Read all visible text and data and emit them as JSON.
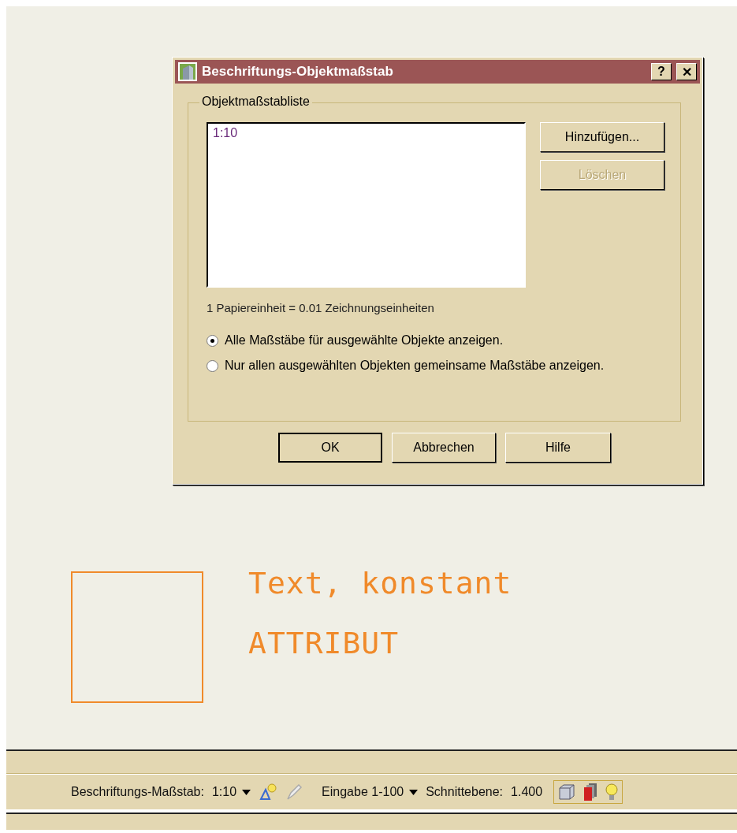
{
  "dialog": {
    "title": "Beschriftungs-Objektmaßstab",
    "help_button": "?",
    "close_button": "✕",
    "group_label": "Objektmaßstabliste",
    "scale_list": [
      {
        "label": "1:10",
        "selected": false
      }
    ],
    "side_buttons": [
      {
        "label": "Hinzufügen...",
        "disabled": false
      },
      {
        "label": "Löschen",
        "disabled": true
      }
    ],
    "info": "1 Papiereinheit = 0.01 Zeichnungseinheiten",
    "options": [
      {
        "label": "Alle Maßstäbe für ausgewählte Objekte anzeigen.",
        "selected": true
      },
      {
        "label": "Nur allen ausgewählten Objekten gemeinsame Maßstäbe anzeigen.",
        "selected": false
      }
    ],
    "buttons": [
      {
        "label": "OK",
        "default": true
      },
      {
        "label": "Abbrechen",
        "default": false
      },
      {
        "label": "Hilfe",
        "default": false
      }
    ]
  },
  "drawing": {
    "texts": [
      "Text, konstant",
      "ATTRIBUT"
    ]
  },
  "status_bar": {
    "annotation_scale_label": "Beschriftungs-Maßstab:",
    "annotation_scale": "1:10",
    "input_mode": "Eingabe 1-100",
    "section_label": "Schnittebene:",
    "section_value": "1.400"
  }
}
